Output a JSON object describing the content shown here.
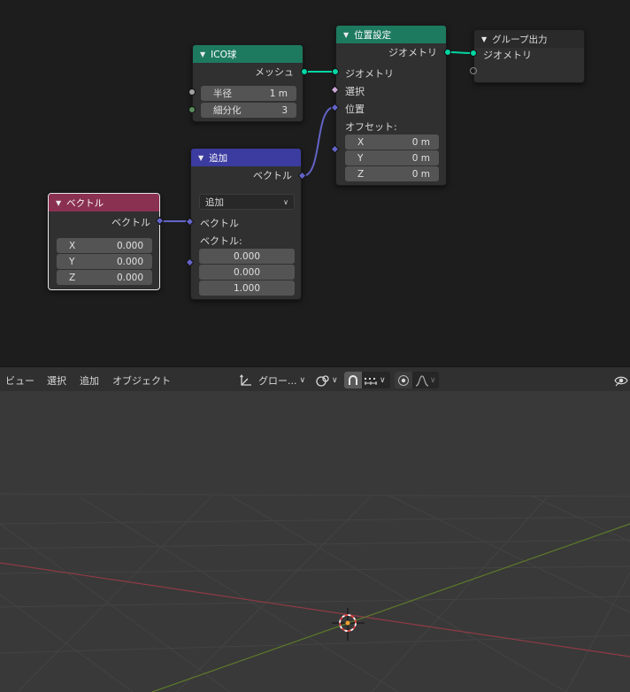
{
  "nodes": {
    "ico_sphere": {
      "title": "ICO球",
      "output": "メッシュ",
      "radius_label": "半径",
      "radius_value": "1 m",
      "subdiv_label": "細分化",
      "subdiv_value": "3",
      "header_color": "#1d7a5f"
    },
    "set_position": {
      "title": "位置設定",
      "output": "ジオメトリ",
      "in_geometry": "ジオメトリ",
      "in_selection": "選択",
      "in_position": "位置",
      "offset_label": "オフセット:",
      "offset": [
        {
          "axis": "X",
          "value": "0 m"
        },
        {
          "axis": "Y",
          "value": "0 m"
        },
        {
          "axis": "Z",
          "value": "0 m"
        }
      ],
      "header_color": "#1d7a5f"
    },
    "group_output": {
      "title": "グループ出力",
      "in_geometry": "ジオメトリ",
      "header_color": "#2a2a2a"
    },
    "add": {
      "title": "追加",
      "output": "ベクトル",
      "operation": "追加",
      "in_vector": "ベクトル",
      "vector_label": "ベクトル:",
      "values": [
        "0.000",
        "0.000",
        "1.000"
      ],
      "header_color": "#3b3ba0"
    },
    "vector": {
      "title": "ベクトル",
      "output": "ベクトル",
      "components": [
        {
          "axis": "X",
          "value": "0.000"
        },
        {
          "axis": "Y",
          "value": "0.000"
        },
        {
          "axis": "Z",
          "value": "0.000"
        }
      ],
      "header_color": "#8a3050"
    }
  },
  "viewport_header": {
    "menu": [
      "ビュー",
      "選択",
      "追加",
      "オブジェクト"
    ],
    "orientation": "グロー..."
  }
}
